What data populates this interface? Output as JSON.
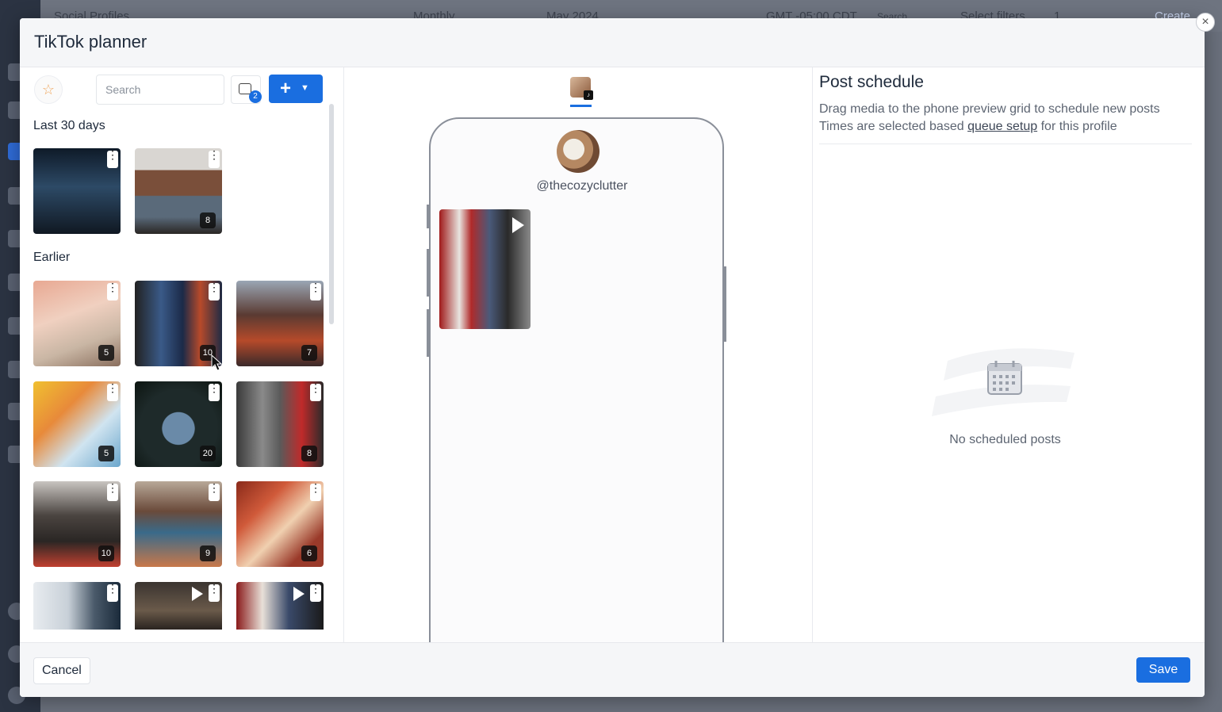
{
  "background_app": {
    "title": "Social Profiles",
    "view_mode": "Monthly",
    "month": "May 2024",
    "timezone": "GMT -05:00 CDT",
    "search_label": "Search",
    "filter_label": "Select filters",
    "filter_count": "1",
    "create_label": "Create"
  },
  "modal": {
    "title": "TikTok planner",
    "close_label": "×"
  },
  "left": {
    "favorite_icon": "star-icon",
    "search_placeholder": "Search",
    "filter_badge": "2",
    "add_label": "+",
    "sections": [
      {
        "label": "Last 30 days"
      },
      {
        "label": "Earlier"
      }
    ],
    "recent_media": [
      {
        "count": "",
        "type": "image"
      },
      {
        "count": "8",
        "type": "carousel"
      }
    ],
    "earlier_media": [
      {
        "count": "5"
      },
      {
        "count": "10"
      },
      {
        "count": "7"
      },
      {
        "count": "5"
      },
      {
        "count": "20"
      },
      {
        "count": "8"
      },
      {
        "count": "10"
      },
      {
        "count": "9"
      },
      {
        "count": "6"
      },
      {
        "count": ""
      },
      {
        "count": ""
      },
      {
        "count": ""
      }
    ]
  },
  "center": {
    "profile_handle": "@thecozyclutter"
  },
  "right": {
    "title": "Post schedule",
    "desc_line1": "Drag media to the phone preview grid to schedule new posts",
    "desc_line2_pre": "Times are selected based",
    "desc_link": "queue setup",
    "desc_line2_post": "for this profile",
    "empty_text": "No scheduled posts"
  },
  "footer": {
    "cancel_label": "Cancel",
    "save_label": "Save"
  },
  "colors": {
    "primary": "#1a6ee0",
    "text": "#1e2a3b",
    "muted": "#5d6572"
  }
}
